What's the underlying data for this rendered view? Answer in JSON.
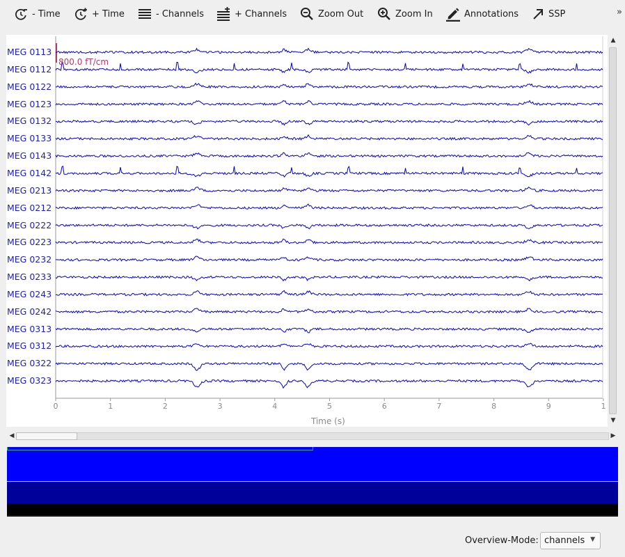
{
  "toolbar": {
    "buttons": [
      {
        "label": "- Time",
        "icon": "clock-minus-icon"
      },
      {
        "label": "+ Time",
        "icon": "clock-plus-icon"
      },
      {
        "label": "- Channels",
        "icon": "channels-minus-icon"
      },
      {
        "label": "+ Channels",
        "icon": "channels-plus-icon"
      },
      {
        "label": "Zoom Out",
        "icon": "zoom-out-icon"
      },
      {
        "label": "Zoom In",
        "icon": "zoom-in-icon"
      },
      {
        "label": "Annotations",
        "icon": "pencil-icon"
      },
      {
        "label": "SSP",
        "icon": "arrow-up-right-icon"
      }
    ],
    "more": "»"
  },
  "plot": {
    "channels": [
      "MEG 0113",
      "MEG 0112",
      "MEG 0122",
      "MEG 0123",
      "MEG 0132",
      "MEG 0133",
      "MEG 0143",
      "MEG 0142",
      "MEG 0213",
      "MEG 0212",
      "MEG 0222",
      "MEG 0223",
      "MEG 0232",
      "MEG 0233",
      "MEG 0243",
      "MEG 0242",
      "MEG 0313",
      "MEG 0312",
      "MEG 0322",
      "MEG 0323"
    ],
    "scale_bar": "800.0 fT/cm",
    "xticks": [
      "0",
      "1",
      "2",
      "3",
      "4",
      "5",
      "6",
      "7",
      "8",
      "9",
      "1"
    ],
    "xlabel": "Time (s)",
    "trace_color": "#0000cc",
    "label_color": "#1f1fb0",
    "scale_color": "#b03a6b"
  },
  "overview": {
    "mode_label": "Overview-Mode:",
    "mode_value": "channels",
    "colors": {
      "row1": "#0000ff",
      "row2": "#00009b",
      "row3": "#000000"
    }
  }
}
